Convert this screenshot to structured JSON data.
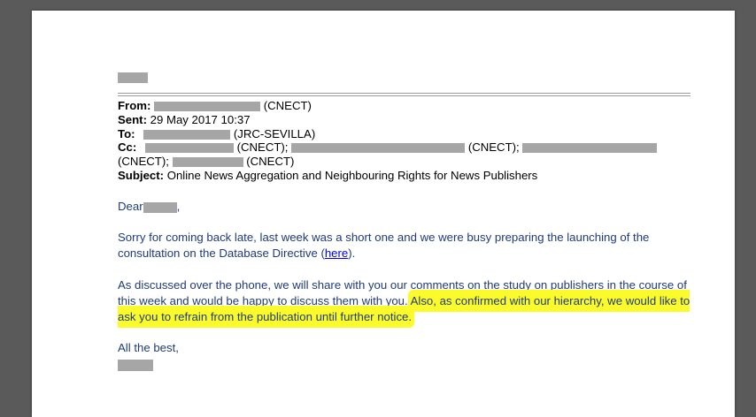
{
  "header": {
    "from_label": "From:",
    "from_org": "(CNECT)",
    "sent_label": "Sent:",
    "sent_value": "29 May 2017 10:37",
    "to_label": "To:",
    "to_org": "(JRC-SEVILLA)",
    "cc_label": "Cc:",
    "cc_org_1": "(CNECT);",
    "cc_org_2": "(CNECT);",
    "cc_org_3": "(CNECT);",
    "cc_org_4": "(CNECT)",
    "subject_label": "Subject:",
    "subject_value": "Online News Aggregation and Neighbouring Rights for News Publishers"
  },
  "body": {
    "greeting": "Dear",
    "greeting_comma": ",",
    "para1_text": "Sorry for coming back late, last week was a short one and we were busy preparing the launching of the consultation on the Database Directive (",
    "para1_link": "here",
    "para1_end": ").",
    "para2_text": "As discussed over the phone, we will share with you our comments on the study on publishers in the course of this week and would be happy to discuss them with you. ",
    "para2_highlight": "Also, as confirmed with our hierarchy, we would like to ask you to refrain from the publication until further notice.",
    "closing": "All the best,"
  },
  "colors": {
    "body_text": "#1f3b78",
    "highlight": "#fbfb2c",
    "redaction": "#a6a6a6",
    "link": "#0000ee"
  }
}
